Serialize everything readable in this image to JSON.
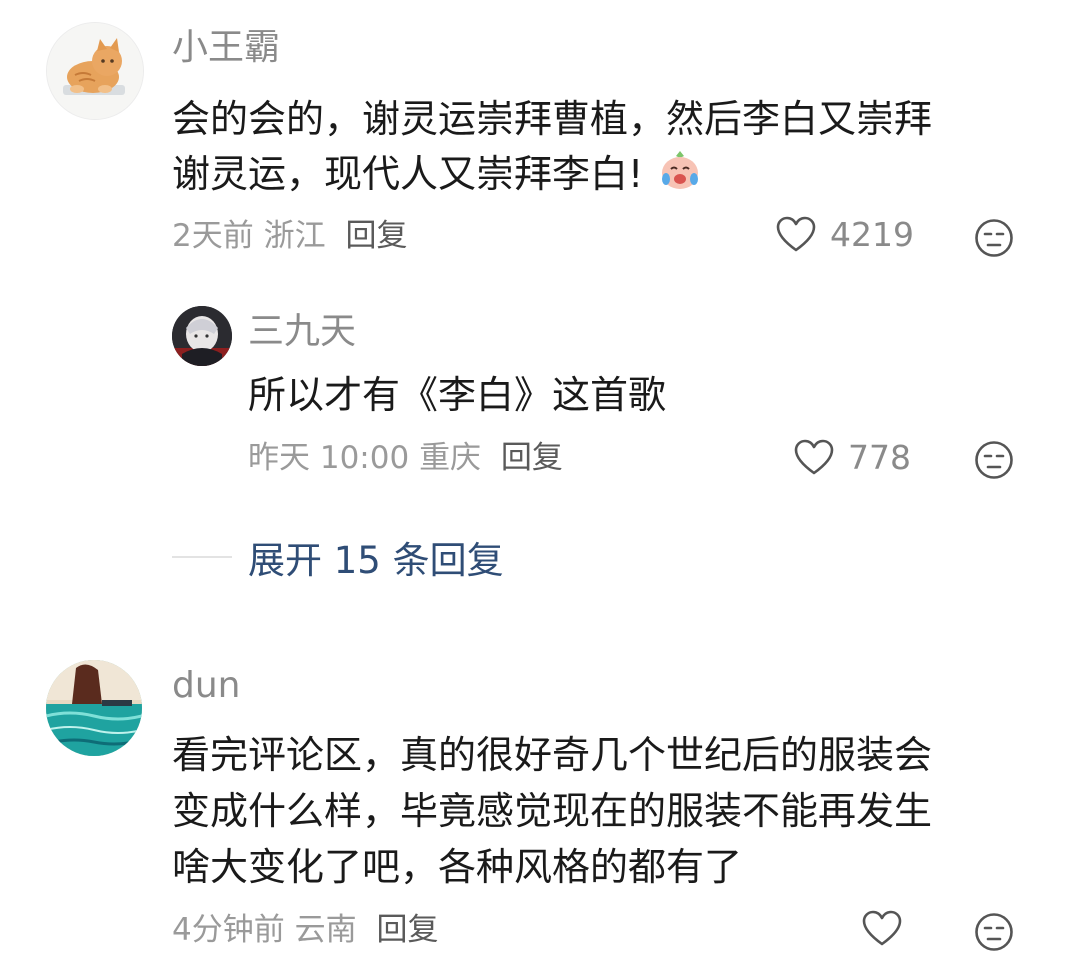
{
  "comments": [
    {
      "username": "小王霸",
      "text_line1": "会的会的，谢灵运崇拜曹植，然后李白又崇拜",
      "text_line2": "谢灵运，现代人又崇拜李白!",
      "emoji": "crying-laughing-emoji",
      "time": "2天前",
      "location": "浙江",
      "reply_label": "回复",
      "likes": "4219",
      "avatar": "cat-avatar",
      "replies": [
        {
          "username": "三九天",
          "text": "所以才有《李白》这首歌",
          "time": "昨天 10:00",
          "location": "重庆",
          "reply_label": "回复",
          "likes": "778",
          "avatar": "anime-character-avatar"
        }
      ],
      "expand_label": "展开 15 条回复"
    },
    {
      "username": "dun",
      "text_line1": "看完评论区，真的很好奇几个世纪后的服装会",
      "text_line2": "变成什么样，毕竟感觉现在的服装不能再发生",
      "text_line3": "啥大变化了吧，各种风格的都有了",
      "time": "4分钟前",
      "location": "云南",
      "reply_label": "回复",
      "likes": "",
      "avatar": "seascape-avatar"
    }
  ],
  "colors": {
    "username": "#8a8a8a",
    "text": "#1a1a1a",
    "meta": "#9a9a9a",
    "expand_link": "#2f4d76",
    "icon_stroke": "#555555"
  }
}
